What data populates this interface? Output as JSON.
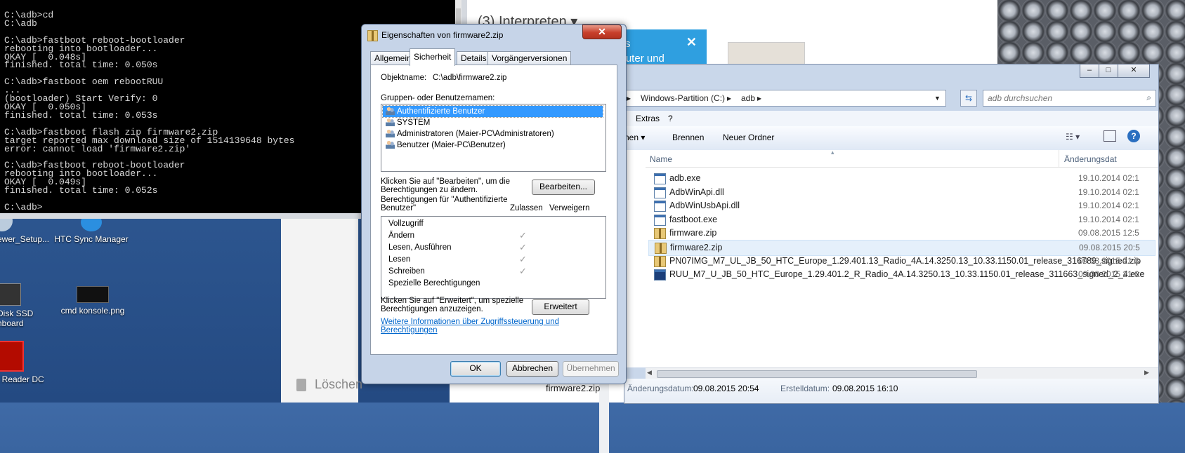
{
  "cmd": {
    "lines": [
      "C:\\adb>cd",
      "C:\\adb",
      "",
      "C:\\adb>fastboot reboot-bootloader",
      "rebooting into bootloader...",
      "OKAY [  0.048s]",
      "finished. total time: 0.050s",
      "",
      "C:\\adb>fastboot oem rebootRUU",
      "...",
      "(bootloader) Start Verify: 0",
      "OKAY [  0.050s]",
      "finished. total time: 0.053s",
      "",
      "C:\\adb>fastboot flash zip firmware2.zip",
      "target reported max download size of 1514139648 bytes",
      "error: cannot load 'firmware2.zip'",
      "",
      "C:\\adb>fastboot reboot-bootloader",
      "rebooting into bootloader...",
      "OKAY [  0.049s]",
      "finished. total time: 0.052s",
      "",
      "C:\\adb>"
    ]
  },
  "desktop": {
    "icons": [
      {
        "label": "ewer_Setup..."
      },
      {
        "label": "HTC Sync Manager"
      },
      {
        "label": "Disk SSD\nhboard"
      },
      {
        "label": "cmd konsole.png"
      },
      {
        "label": "t Reader DC"
      }
    ]
  },
  "browser": {
    "heading": "(3) Interpreten ▾",
    "tip_text": "chts\nmputer und\nhalten",
    "tip_close": "✕",
    "delete_label": "Löschen"
  },
  "explorer": {
    "breadcrumb": [
      "Windows-Partition (C:)",
      "adb"
    ],
    "search_placeholder": "adb durchsuchen",
    "menu": [
      "Extras",
      "?"
    ],
    "toolbar": {
      "organize": "nen ▾",
      "burn": "Brennen",
      "new_folder": "Neuer Ordner"
    },
    "columns": {
      "name": "Name",
      "date": "Änderungsdat"
    },
    "files": [
      {
        "name": "adb.exe",
        "date": "19.10.2014 02:1",
        "type": "exe"
      },
      {
        "name": "AdbWinApi.dll",
        "date": "19.10.2014 02:1",
        "type": "dll"
      },
      {
        "name": "AdbWinUsbApi.dll",
        "date": "19.10.2014 02:1",
        "type": "dll"
      },
      {
        "name": "fastboot.exe",
        "date": "19.10.2014 02:1",
        "type": "exe"
      },
      {
        "name": "firmware.zip",
        "date": "09.08.2015 12:5",
        "type": "zip"
      },
      {
        "name": "firmware2.zip",
        "date": "09.08.2015 20:5",
        "type": "zip"
      },
      {
        "name": "PN07IMG_M7_UL_JB_50_HTC_Europe_1.29.401.13_Radio_4A.14.3250.13_10.33.1150.01_release_316789_signed.zip",
        "date": "09.08.2015 21:3",
        "type": "zip"
      },
      {
        "name": "RUU_M7_U_JB_50_HTC_Europe_1.29.401.2_R_Radio_4A.14.3250.13_10.33.1150.01_release_311663_signed_2_4.exe",
        "date": "09.08.2015 21:0",
        "type": "ruu"
      }
    ],
    "details": {
      "filename": "firmware2.zip",
      "modified_label": "Änderungsdatum:",
      "modified_value": "09.08.2015 20:54",
      "created_label": "Erstelldatum:",
      "created_value": "09.08.2015 16:10"
    }
  },
  "dialog": {
    "title": "Eigenschaften von firmware2.zip",
    "close": "✕",
    "tabs": [
      "Allgemein",
      "Sicherheit",
      "Details",
      "Vorgängerversionen"
    ],
    "object_label": "Objektname:",
    "object_value": "C:\\adb\\firmware2.zip",
    "groups_label": "Gruppen- oder Benutzernamen:",
    "users": [
      "Authentifizierte Benutzer",
      "SYSTEM",
      "Administratoren (Maier-PC\\Administratoren)",
      "Benutzer (Maier-PC\\Benutzer)"
    ],
    "edit_hint": "Klicken Sie auf \"Bearbeiten\", um die\nBerechtigungen zu ändern.",
    "edit_button": "Bearbeiten...",
    "perm_label": "Berechtigungen für \"Authentifizierte\nBenutzer\"",
    "allow_label": "Zulassen",
    "deny_label": "Verweigern",
    "permissions": [
      {
        "name": "Vollzugriff",
        "allow": false
      },
      {
        "name": "Ändern",
        "allow": true
      },
      {
        "name": "Lesen, Ausführen",
        "allow": true
      },
      {
        "name": "Lesen",
        "allow": true
      },
      {
        "name": "Schreiben",
        "allow": true
      },
      {
        "name": "Spezielle Berechtigungen",
        "allow": false
      }
    ],
    "check_glyph": "✓",
    "advanced_hint": "Klicken Sie auf \"Erweitert\", um spezielle\nBerechtigungen anzuzeigen.",
    "advanced_button": "Erweitert",
    "more_info_link": "Weitere Informationen über Zugriffssteuerung und Berechtigungen",
    "ok": "OK",
    "cancel": "Abbrechen",
    "apply": "Übernehmen"
  }
}
